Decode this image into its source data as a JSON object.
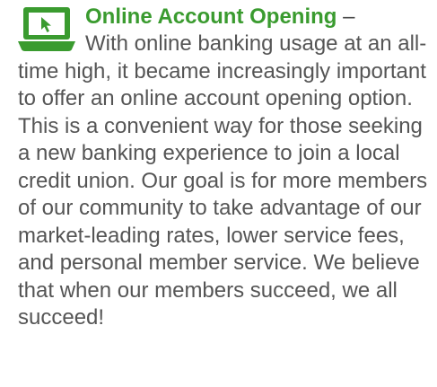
{
  "feature": {
    "icon": "laptop-cursor-icon",
    "accent_color": "#3a9b2f",
    "text_color": "#555555",
    "title": "Online Account Opening",
    "separator": " –",
    "body": "With online banking usage at an all-time high, it became increasingly important to offer an online account opening option. This is a convenient way for those seeking a new banking experience to join a local credit union. Our goal is for more members of our community to take advantage of our market-leading rates, lower service fees, and personal member service. We believe that when our members succeed, we all succeed!"
  }
}
